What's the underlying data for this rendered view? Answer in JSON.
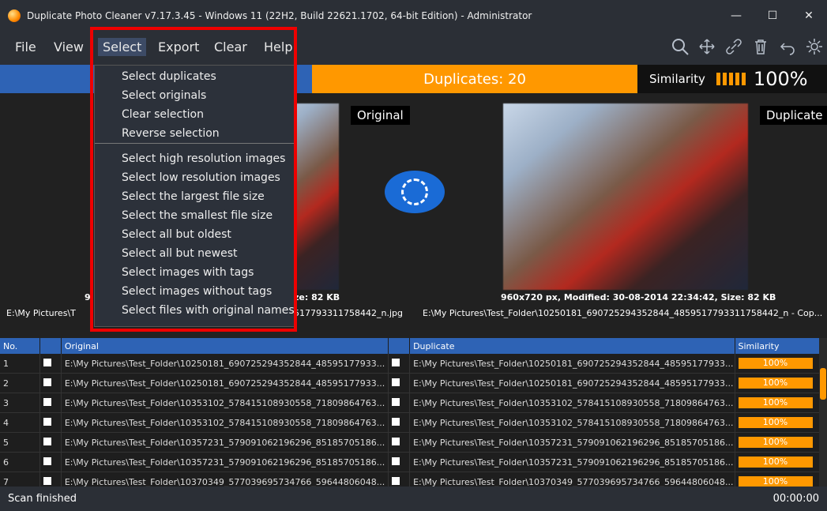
{
  "window": {
    "title": "Duplicate Photo Cleaner v7.17.3.45 - Windows 11 (22H2, Build 22621.1702, 64-bit Edition) - Administrator",
    "controls": [
      "—",
      "☐",
      "✕"
    ]
  },
  "menubar": {
    "items": [
      "File",
      "View",
      "Select",
      "Export",
      "Clear",
      "Help"
    ],
    "active": "Select"
  },
  "toolbar": {
    "icons": [
      "search-icon",
      "move-icon",
      "link-icon",
      "trash-icon",
      "undo-icon",
      "gear-icon"
    ]
  },
  "counts": {
    "duplicates_label": "Duplicates: 20",
    "similarity_label": "Similarity",
    "similarity_value": "100%",
    "similarity_bars": 5,
    "colors": {
      "blue": "#2e63b5",
      "orange": "#ff9800"
    }
  },
  "preview": {
    "original_label": "Original",
    "duplicate_label": "Duplicate",
    "left_info_partial_number": "9",
    "left_size_partial": "ze: 82 KB",
    "left_path_partial": "E:\\My Pictures\\T",
    "left_file_partial": "517793311758442_n.jpg",
    "right_info": "960x720 px, Modified: 30-08-2014 22:34:42, Size: 82 KB",
    "right_path": "E:\\My Pictures\\Test_Folder\\10250181_690725294352844_4859517793311758442_n - Cop..."
  },
  "table": {
    "headers": [
      "No.",
      "Original",
      "Duplicate",
      "Similarity"
    ],
    "rows": [
      {
        "no": "1",
        "orig": "E:\\My Pictures\\Test_Folder\\10250181_690725294352844_48595177933...",
        "dup": "E:\\My Pictures\\Test_Folder\\10250181_690725294352844_48595177933...",
        "sim": "100%"
      },
      {
        "no": "2",
        "orig": "E:\\My Pictures\\Test_Folder\\10250181_690725294352844_48595177933...",
        "dup": "E:\\My Pictures\\Test_Folder\\10250181_690725294352844_48595177933...",
        "sim": "100%"
      },
      {
        "no": "3",
        "orig": "E:\\My Pictures\\Test_Folder\\10353102_578415108930558_71809864763...",
        "dup": "E:\\My Pictures\\Test_Folder\\10353102_578415108930558_71809864763...",
        "sim": "100%"
      },
      {
        "no": "4",
        "orig": "E:\\My Pictures\\Test_Folder\\10353102_578415108930558_71809864763...",
        "dup": "E:\\My Pictures\\Test_Folder\\10353102_578415108930558_71809864763...",
        "sim": "100%"
      },
      {
        "no": "5",
        "orig": "E:\\My Pictures\\Test_Folder\\10357231_579091062196296_85185705186...",
        "dup": "E:\\My Pictures\\Test_Folder\\10357231_579091062196296_85185705186...",
        "sim": "100%"
      },
      {
        "no": "6",
        "orig": "E:\\My Pictures\\Test_Folder\\10357231_579091062196296_85185705186...",
        "dup": "E:\\My Pictures\\Test_Folder\\10357231_579091062196296_85185705186...",
        "sim": "100%"
      },
      {
        "no": "7",
        "orig": "E:\\My Pictures\\Test_Folder\\10370349_577039695734766_59644806048...",
        "dup": "E:\\My Pictures\\Test_Folder\\10370349_577039695734766_59644806048...",
        "sim": "100%"
      }
    ]
  },
  "status": {
    "left": "Scan finished",
    "right": "00:00:00"
  },
  "select_menu": {
    "group1": [
      "Select duplicates",
      "Select originals",
      "Clear selection",
      "Reverse selection"
    ],
    "group2": [
      "Select high resolution images",
      "Select low resolution images",
      "Select the largest file size",
      "Select the smallest file size",
      "Select all but oldest",
      "Select all but newest",
      "Select images with tags",
      "Select images without tags",
      "Select files with original names"
    ]
  }
}
